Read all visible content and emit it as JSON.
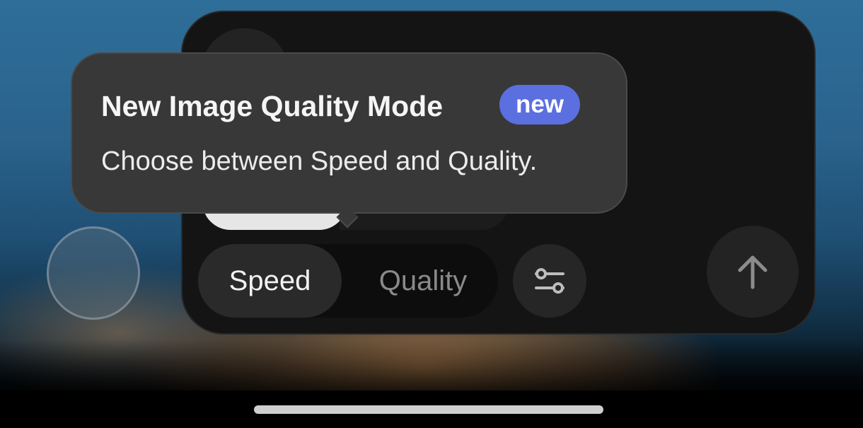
{
  "tooltip": {
    "title": "New Image Quality Mode",
    "badge": "new",
    "description": "Choose between Speed and Quality."
  },
  "mode_toggle": {
    "options": [
      "Speed",
      "Quality"
    ],
    "selected": "Speed"
  },
  "icons": {
    "settings": "sliders-icon",
    "send": "arrow-up-icon"
  },
  "colors": {
    "badge": "#5b6fe0",
    "panel": "#141414",
    "tooltip": "#383838"
  }
}
